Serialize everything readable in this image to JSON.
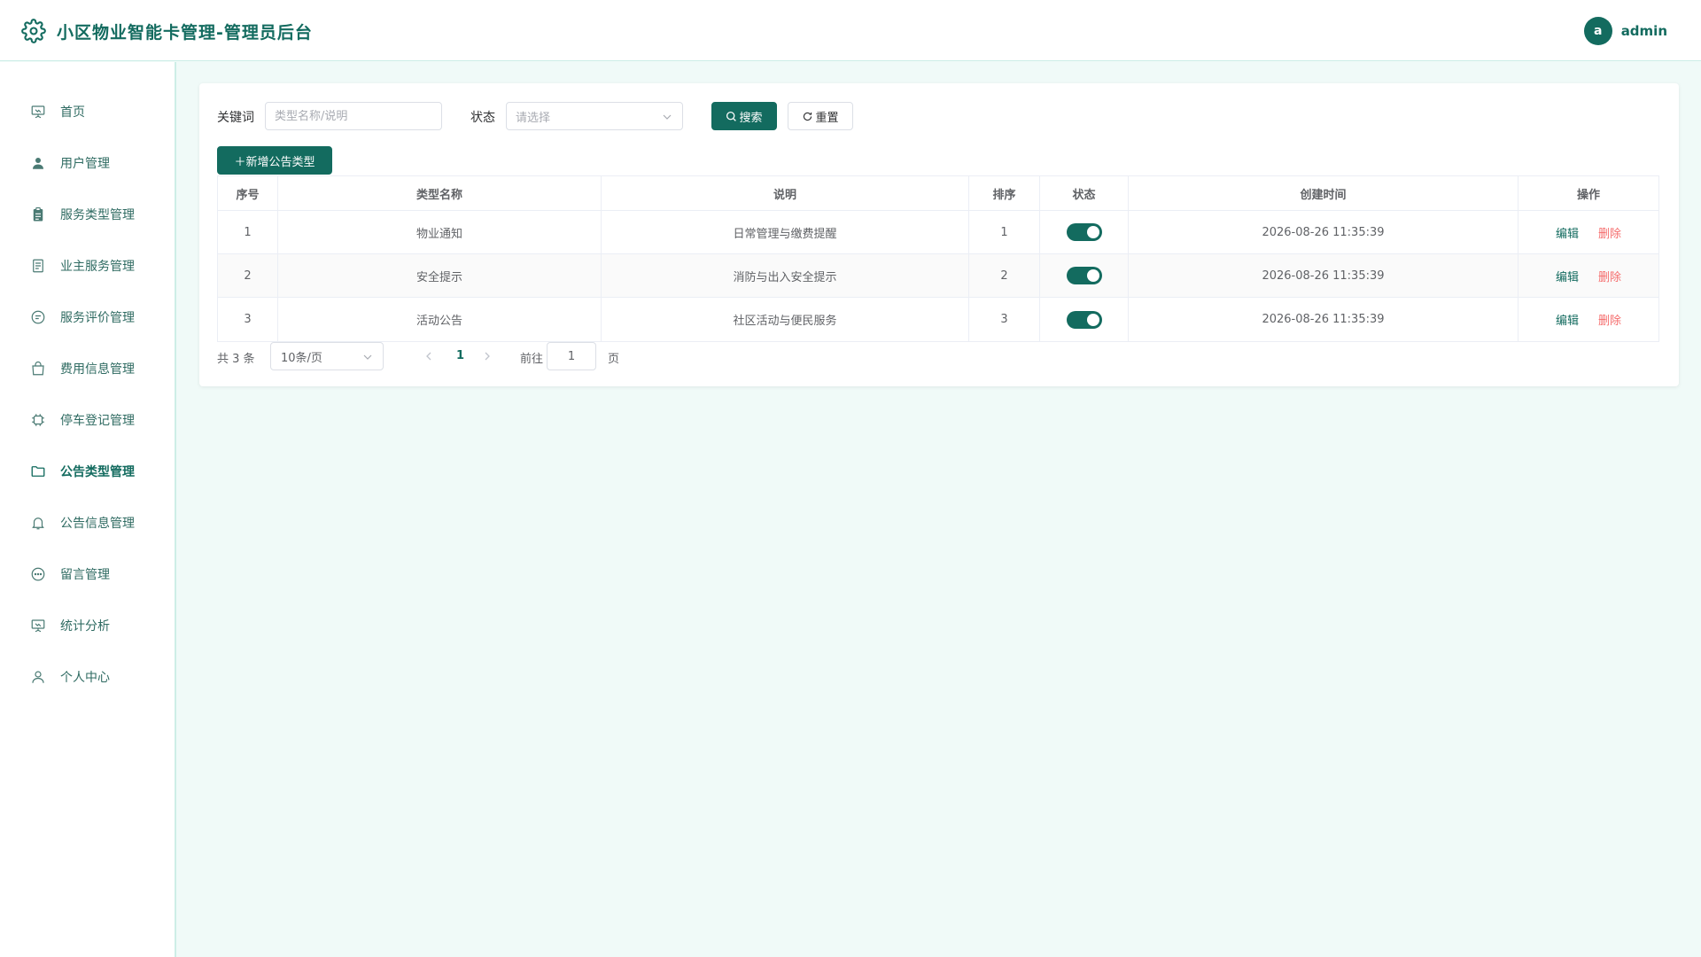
{
  "header": {
    "title": "小区物业智能卡管理-管理员后台",
    "avatar_letter": "a",
    "username": "admin"
  },
  "sidebar": {
    "items": [
      {
        "label": "首页",
        "icon": "presentation-icon"
      },
      {
        "label": "用户管理",
        "icon": "user-icon"
      },
      {
        "label": "服务类型管理",
        "icon": "clipboard-icon"
      },
      {
        "label": "业主服务管理",
        "icon": "document-icon"
      },
      {
        "label": "服务评价管理",
        "icon": "chat-icon"
      },
      {
        "label": "费用信息管理",
        "icon": "shopping-bag-icon"
      },
      {
        "label": "停车登记管理",
        "icon": "chip-icon"
      },
      {
        "label": "公告类型管理",
        "icon": "folder-icon",
        "active": true
      },
      {
        "label": "公告信息管理",
        "icon": "bell-icon"
      },
      {
        "label": "留言管理",
        "icon": "message-icon"
      },
      {
        "label": "统计分析",
        "icon": "chart-board-icon"
      },
      {
        "label": "个人中心",
        "icon": "user-outline-icon"
      }
    ]
  },
  "filters": {
    "keyword_label": "关键词",
    "keyword_placeholder": "类型名称/说明",
    "keyword_value": "",
    "status_label": "状态",
    "status_placeholder": "请选择",
    "search_label": "搜索",
    "reset_label": "重置"
  },
  "toolbar": {
    "add_label": "＋新增公告类型"
  },
  "table": {
    "columns": [
      "序号",
      "类型名称",
      "说明",
      "排序",
      "状态",
      "创建时间",
      "操作"
    ],
    "rows": [
      {
        "index": "1",
        "name": "物业通知",
        "desc": "日常管理与缴费提醒",
        "sort": "1",
        "status": true,
        "created": "2026-08-26 11:35:39"
      },
      {
        "index": "2",
        "name": "安全提示",
        "desc": "消防与出入安全提示",
        "sort": "2",
        "status": true,
        "created": "2026-08-26 11:35:39"
      },
      {
        "index": "3",
        "name": "活动公告",
        "desc": "社区活动与便民服务",
        "sort": "3",
        "status": true,
        "created": "2026-08-26 11:35:39"
      }
    ],
    "edit_label": "编辑",
    "delete_label": "删除"
  },
  "pagination": {
    "total_text": "共 3 条",
    "page_size": "10条/页",
    "current_page": "1",
    "goto_label": "前往",
    "goto_value": "1",
    "page_unit": "页"
  },
  "colors": {
    "primary": "#136b5f",
    "danger": "#f56c6c",
    "background": "#f0faf8"
  }
}
